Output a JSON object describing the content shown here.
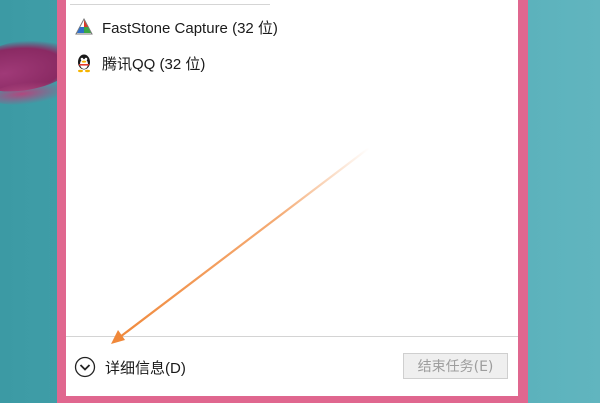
{
  "window": {
    "apps": [
      {
        "name": "FastStone Capture (32 位)",
        "icon": "faststone-capture-icon"
      },
      {
        "name": "腾讯QQ (32 位)",
        "icon": "qq-penguin-icon"
      }
    ]
  },
  "footer": {
    "details_label": "详细信息(D)",
    "details_icon": "chevron-down-circle-icon",
    "end_task_label": "结束任务(E)",
    "end_task_enabled": false
  },
  "annotation": {
    "arrow_color": "#f0883a"
  },
  "colors": {
    "window_border": "#e0678f",
    "background_teal": "#4aa8b2"
  }
}
